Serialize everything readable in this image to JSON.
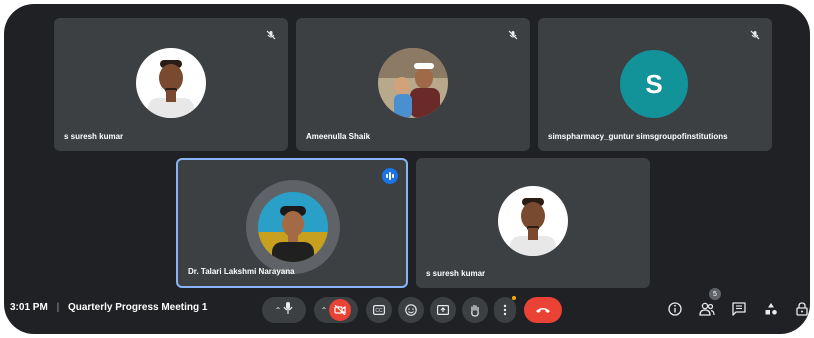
{
  "tiles": [
    {
      "name": "s suresh kumar",
      "muted": true
    },
    {
      "name": "Ameenulla Shaik",
      "muted": true
    },
    {
      "name": "simspharmacy_guntur simsgroupofinstitutions",
      "muted": true,
      "avatar_letter": "S"
    },
    {
      "name": "Dr. Talari Lakshmi Narayana",
      "speaking": true
    },
    {
      "name": "s suresh kumar"
    }
  ],
  "meeting": {
    "time": "3:01 PM",
    "separator": "|",
    "title": "Quarterly Progress Meeting 1"
  },
  "participants_count": "5",
  "icons": {
    "mute": "mic-off-icon",
    "speaking": "audio-wave-icon",
    "mic": "mic-icon",
    "camera_off": "camera-off-icon",
    "captions": "captions-icon",
    "emoji": "emoji-icon",
    "present": "present-screen-icon",
    "raise_hand": "raise-hand-icon",
    "more": "more-options-icon",
    "leave": "leave-call-icon",
    "info": "info-icon",
    "people": "people-icon",
    "chat": "chat-icon",
    "activities": "activities-icon",
    "host_controls": "host-controls-icon"
  },
  "colors": {
    "background": "#202124",
    "tile": "#3c4043",
    "speaking_border": "#8ab4f8",
    "leave": "#ea4335",
    "letter_avatar": "#12939a"
  }
}
